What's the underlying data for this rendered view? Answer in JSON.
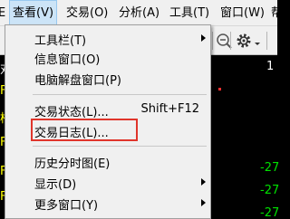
{
  "menubar": {
    "items": [
      {
        "label": "查看(V)",
        "active": true
      },
      {
        "label": "交易(O)"
      },
      {
        "label": "分析(A)"
      },
      {
        "label": "工具(T)"
      },
      {
        "label": "窗口(W)"
      },
      {
        "label": "帮"
      }
    ],
    "left_fragment": "E"
  },
  "toolbar": {
    "icons": [
      "zoom-out-icon",
      "gear-icon",
      "dropdown-icon"
    ]
  },
  "dropdown": {
    "items": [
      {
        "label": "工具栏(T)",
        "submenu": true
      },
      {
        "label": "信息窗口(O)"
      },
      {
        "label": "电脑解盘窗口(P)"
      },
      {
        "label": "交易状态(L)...",
        "shortcut": "Shift+F12"
      },
      {
        "label": "交易日志(L)...",
        "highlighted": true
      },
      {
        "label": "历史分时图(E)"
      },
      {
        "label": "显示(D)",
        "submenu": true
      },
      {
        "label": "更多窗口(Y)",
        "submenu": true
      }
    ]
  },
  "background": {
    "left_chars": [
      "对",
      "F",
      "柏",
      "F",
      "F",
      "F"
    ],
    "right_values": [
      "1",
      "-27",
      "-27",
      "-27"
    ],
    "colors": {
      "yellow": "#ffff00",
      "green": "#00e000",
      "red": "#ff3030",
      "white": "#ffffff"
    }
  }
}
